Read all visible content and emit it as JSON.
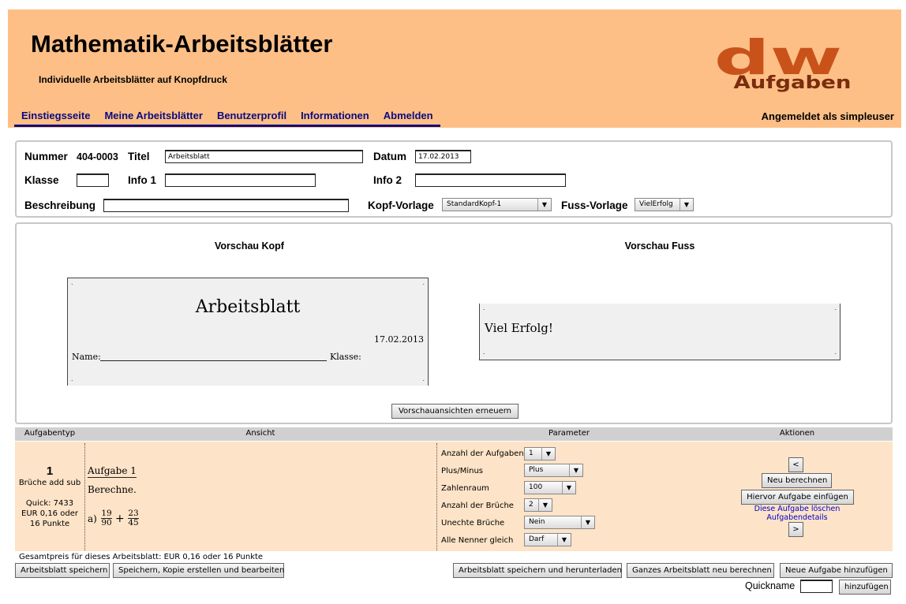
{
  "header": {
    "title": "Mathematik-Arbeitsblätter",
    "subtitle": "Individuelle Arbeitsblätter auf Knopfdruck",
    "logo_letters": "dw",
    "logo_word": "Aufgaben",
    "logo_color": "#c9521b",
    "logged_in": "Angemeldet als simpleuser",
    "nav": [
      "Einstiegsseite",
      "Meine Arbeitsblätter",
      "Benutzerprofil",
      "Informationen",
      "Abmelden"
    ]
  },
  "meta": {
    "nummer_label": "Nummer",
    "nummer_value": "404-0003",
    "titel_label": "Titel",
    "titel_value": "Arbeitsblatt",
    "datum_label": "Datum",
    "datum_value": "17.02.2013",
    "klasse_label": "Klasse",
    "klasse_value": "",
    "info1_label": "Info 1",
    "info1_value": "",
    "info2_label": "Info 2",
    "info2_value": "",
    "beschreibung_label": "Beschreibung",
    "beschreibung_value": "",
    "kopf_label": "Kopf-Vorlage",
    "kopf_value": "StandardKopf-1",
    "fuss_label": "Fuss-Vorlage",
    "fuss_value": "VielErfolg"
  },
  "preview": {
    "kopf_title": "Vorschau Kopf",
    "fuss_title": "Vorschau Fuss",
    "kopf_heading": "Arbeitsblatt",
    "kopf_date": "17.02.2013",
    "kopf_name": "Name:",
    "kopf_klasse": "Klasse:",
    "fuss_text": "Viel Erfolg!",
    "refresh_button": "Vorschauansichten erneuern"
  },
  "table": {
    "headers": [
      "Aufgabentyp",
      "Ansicht",
      "Parameter",
      "Aktionen"
    ],
    "row": {
      "number": "1",
      "type": "Brüche add sub",
      "quick": "Quick: 7433",
      "price": "EUR 0,16 oder",
      "points": "16 Punkte",
      "task_title": "Aufgabe 1",
      "task_instruction": "Berechne.",
      "task_item": "a)",
      "frac1_num": "19",
      "frac1_den": "90",
      "operator": "+",
      "frac2_num": "23",
      "frac2_den": "45",
      "params": [
        {
          "label": "Anzahl der Aufgaben",
          "value": "1"
        },
        {
          "label": "Plus/Minus",
          "value": "Plus"
        },
        {
          "label": "Zahlenraum",
          "value": "100"
        },
        {
          "label": "Anzahl der Brüche",
          "value": "2"
        },
        {
          "label": "Unechte Brüche",
          "value": "Nein"
        },
        {
          "label": "Alle Nenner gleich",
          "value": "Darf"
        }
      ],
      "actions": {
        "prev": "<",
        "recalc": "Neu berechnen",
        "insert_before": "Hiervor Aufgabe einfügen",
        "delete_link": "Diese Aufgabe löschen",
        "details_link": "Aufgabendetails",
        "next": ">"
      }
    }
  },
  "footer": {
    "total": "Gesamtpreis für dieses Arbeitsblatt: EUR 0,16 oder 16 Punkte",
    "save": "Arbeitsblatt speichern",
    "save_copy": "Speichern, Kopie erstellen und bearbeiten",
    "save_download": "Arbeitsblatt speichern und herunterladen",
    "recalc_all": "Ganzes Arbeitsblatt neu berechnen",
    "add_task": "Neue Aufgabe hinzufügen",
    "quickname_label": "Quickname",
    "quickname_value": "",
    "add_button": "hinzufügen"
  }
}
